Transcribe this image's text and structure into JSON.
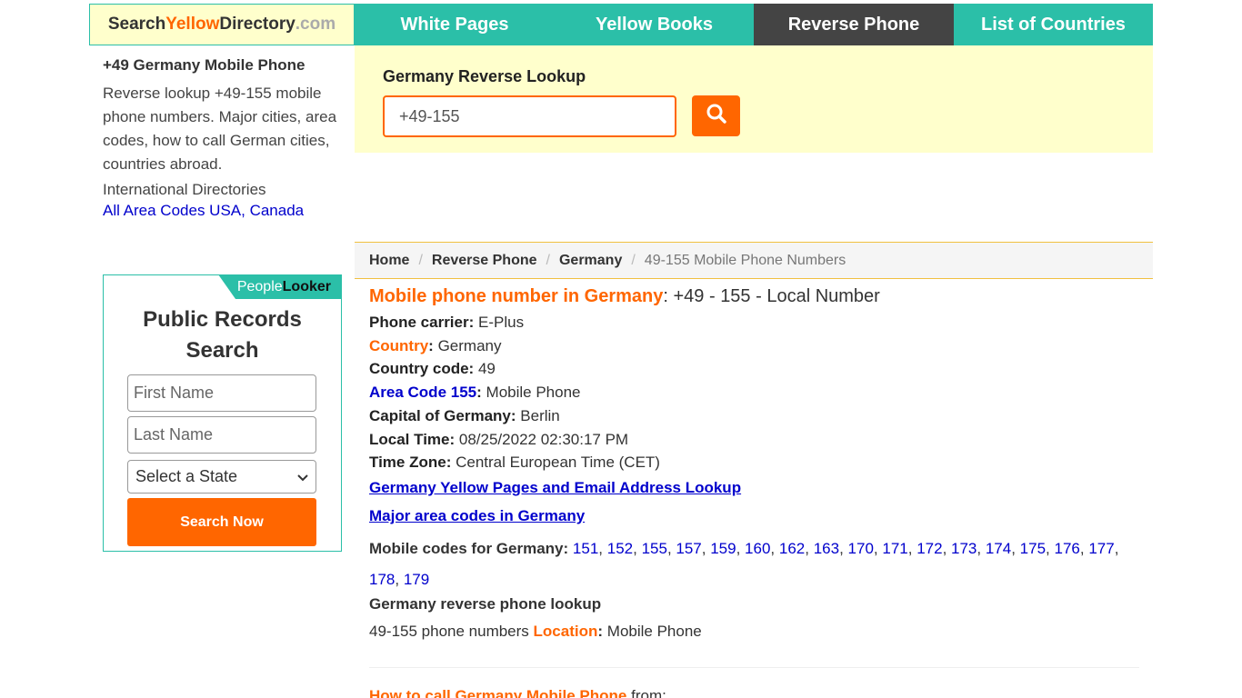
{
  "logo": {
    "part1": "Search",
    "part2": "Yellow",
    "part3": "Directory",
    "part4": ".com"
  },
  "nav": [
    {
      "label": "White Pages",
      "active": false
    },
    {
      "label": "Yellow Books",
      "active": false
    },
    {
      "label": "Reverse Phone",
      "active": true
    },
    {
      "label": "List of Countries",
      "active": false
    }
  ],
  "sidebar": {
    "title": "+49 Germany Mobile Phone",
    "description": "Reverse lookup +49-155 mobile phone numbers. Major cities, area codes, how to call German cities, countries abroad.",
    "intl_label": "International Directories",
    "intl_link": "All Area Codes USA, Canada"
  },
  "public_records": {
    "badge_part1": "People",
    "badge_part2": "Looker",
    "title": "Public Records Search",
    "first_name_placeholder": "First Name",
    "last_name_placeholder": "Last Name",
    "state_select": "Select a State",
    "button": "Search Now"
  },
  "search": {
    "label": "Germany Reverse Lookup",
    "value": "+49-155",
    "button_icon": "search-icon"
  },
  "breadcrumb": {
    "home": "Home",
    "reverse_phone": "Reverse Phone",
    "country": "Germany",
    "current": "49-155 Mobile Phone Numbers"
  },
  "main": {
    "heading_orange": "Mobile phone number in Germany",
    "heading_rest": ": +49 - 155 - Local Number",
    "carrier_label": "Phone carrier:",
    "carrier_value": "E-Plus",
    "country_label": "Country",
    "country_value": "Germany",
    "country_code_label": "Country code:",
    "country_code_value": "49",
    "area_code_label": "Area Code 155",
    "area_code_value": "Mobile Phone",
    "capital_label": "Capital of Germany:",
    "capital_value": "Berlin",
    "local_time_label": "Local Time:",
    "local_time_value": "08/25/2022 02:30:17 PM",
    "timezone_label": "Time Zone:",
    "timezone_value": "Central European Time (CET)",
    "link1": "Germany Yellow Pages and Email Address Lookup",
    "link2": "Major area codes in Germany",
    "mobile_codes_label": "Mobile codes for Germany:",
    "mobile_codes": [
      "151",
      "152",
      "155",
      "157",
      "159",
      "160",
      "162",
      "163",
      "170",
      "171",
      "172",
      "173",
      "174",
      "175",
      "176",
      "177",
      "178",
      "179"
    ],
    "reverse_lookup_title": "Germany reverse phone lookup",
    "location_prefix": "49-155 phone numbers",
    "location_label": "Location",
    "location_value": "Mobile Phone",
    "how_to_call_orange": "How to call Germany Mobile Phone",
    "how_to_call_rest": "from:"
  }
}
